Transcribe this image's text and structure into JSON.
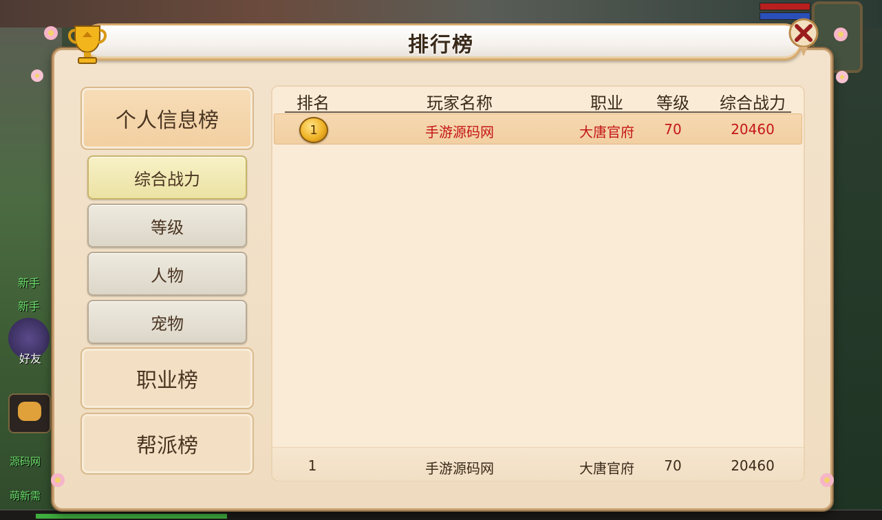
{
  "title": "排行榜",
  "background": {
    "side_text_1": "新手",
    "side_text_2": "新手",
    "friend_label": "好友",
    "channel_1": "源码网",
    "channel_2": "萌新需"
  },
  "categories": [
    {
      "label": "个人信息榜",
      "active": true
    },
    {
      "label": "职业榜",
      "active": false
    },
    {
      "label": "帮派榜",
      "active": false
    }
  ],
  "sub_tabs": [
    {
      "label": "综合战力",
      "active": true
    },
    {
      "label": "等级",
      "active": false
    },
    {
      "label": "人物",
      "active": false
    },
    {
      "label": "宠物",
      "active": false
    }
  ],
  "table": {
    "headers": [
      "排名",
      "玩家名称",
      "职业",
      "等级",
      "综合战力"
    ],
    "rows": [
      {
        "rank": "1",
        "name": "手游源码网",
        "job": "大唐官府",
        "level": "70",
        "power": "20460"
      }
    ],
    "my_rank": {
      "rank": "1",
      "name": "手游源码网",
      "job": "大唐官府",
      "level": "70",
      "power": "20460"
    }
  },
  "colors": {
    "highlight_text": "#c41616",
    "panel_bg": "#f3e3cc",
    "table_bg": "#faebd6",
    "border": "#c9a070"
  }
}
